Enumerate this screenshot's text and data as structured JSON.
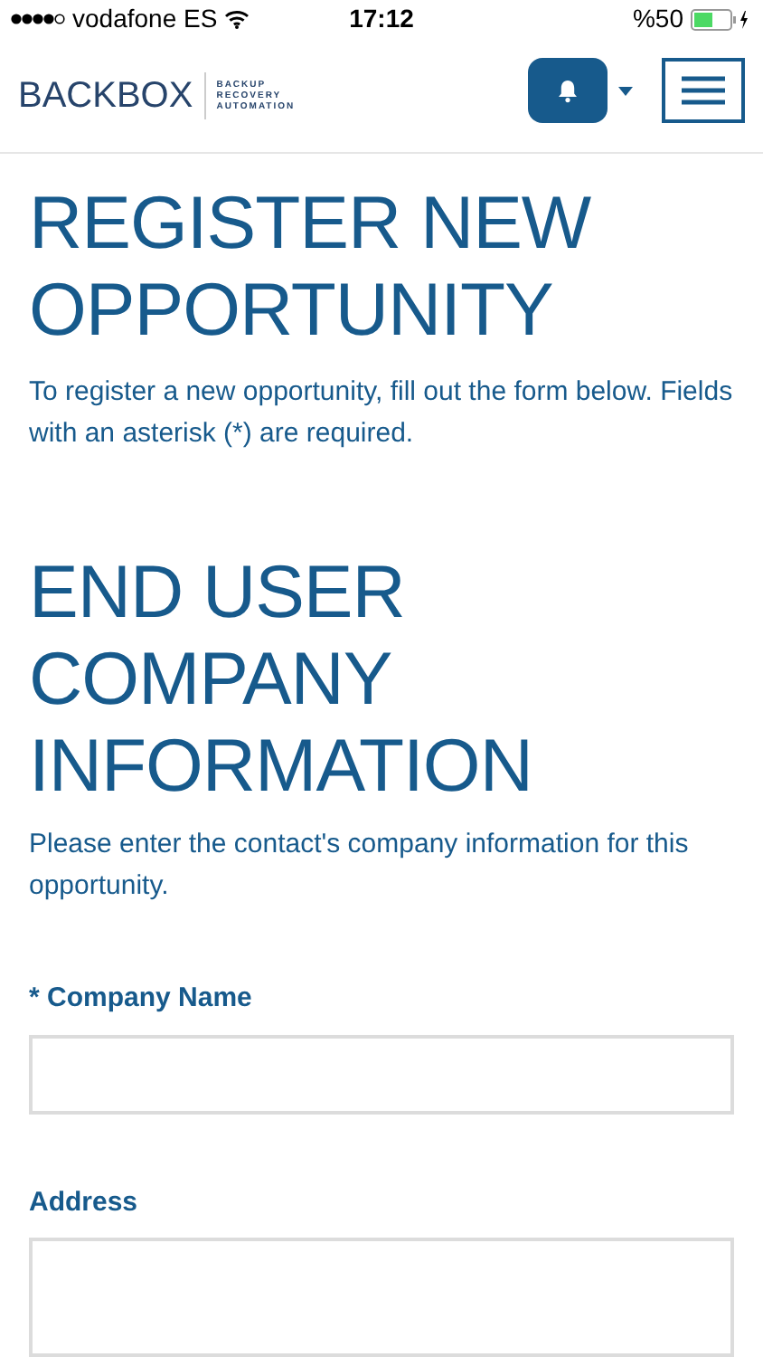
{
  "status_bar": {
    "carrier": "vodafone ES",
    "time": "17:12",
    "battery": "%50"
  },
  "header": {
    "logo": "BACKBOX",
    "tagline": [
      "BACKUP",
      "RECOVERY",
      "AUTOMATION"
    ]
  },
  "page_title": "REGISTER NEW OPPORTUNITY",
  "intro": "To register a new opportunity, fill out the form below. Fields with an asterisk (*) are required.",
  "section": {
    "title": "END USER COMPANY INFORMATION",
    "description": "Please enter the contact's company information for this opportunity."
  },
  "fields": [
    {
      "label": "* Company Name",
      "kind": "input"
    },
    {
      "label": "Address",
      "kind": "textarea"
    }
  ]
}
